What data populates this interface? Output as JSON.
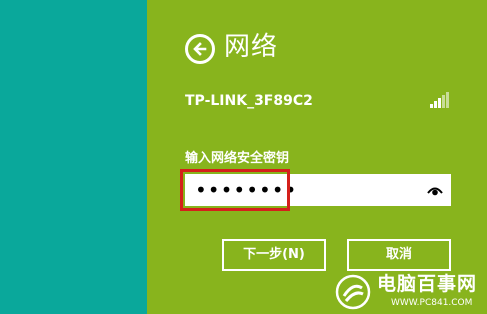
{
  "header": {
    "back_icon": "arrow-left-circle-icon",
    "title": "网络"
  },
  "network": {
    "ssid": "TP-LINK_3F89C2",
    "signal_icon": "wifi-signal-icon"
  },
  "password": {
    "label": "输入网络安全密钥",
    "masked_value": "••••••••",
    "reveal_icon": "eye-icon"
  },
  "buttons": {
    "next_label": "下一步(N)",
    "cancel_label": "取消"
  },
  "colors": {
    "left_strip": "#0aa89b",
    "panel": "#88b41d",
    "highlight": "#d4201b"
  },
  "watermark": {
    "brand": "电脑百事网",
    "url": "WWW.PC841.COM"
  }
}
